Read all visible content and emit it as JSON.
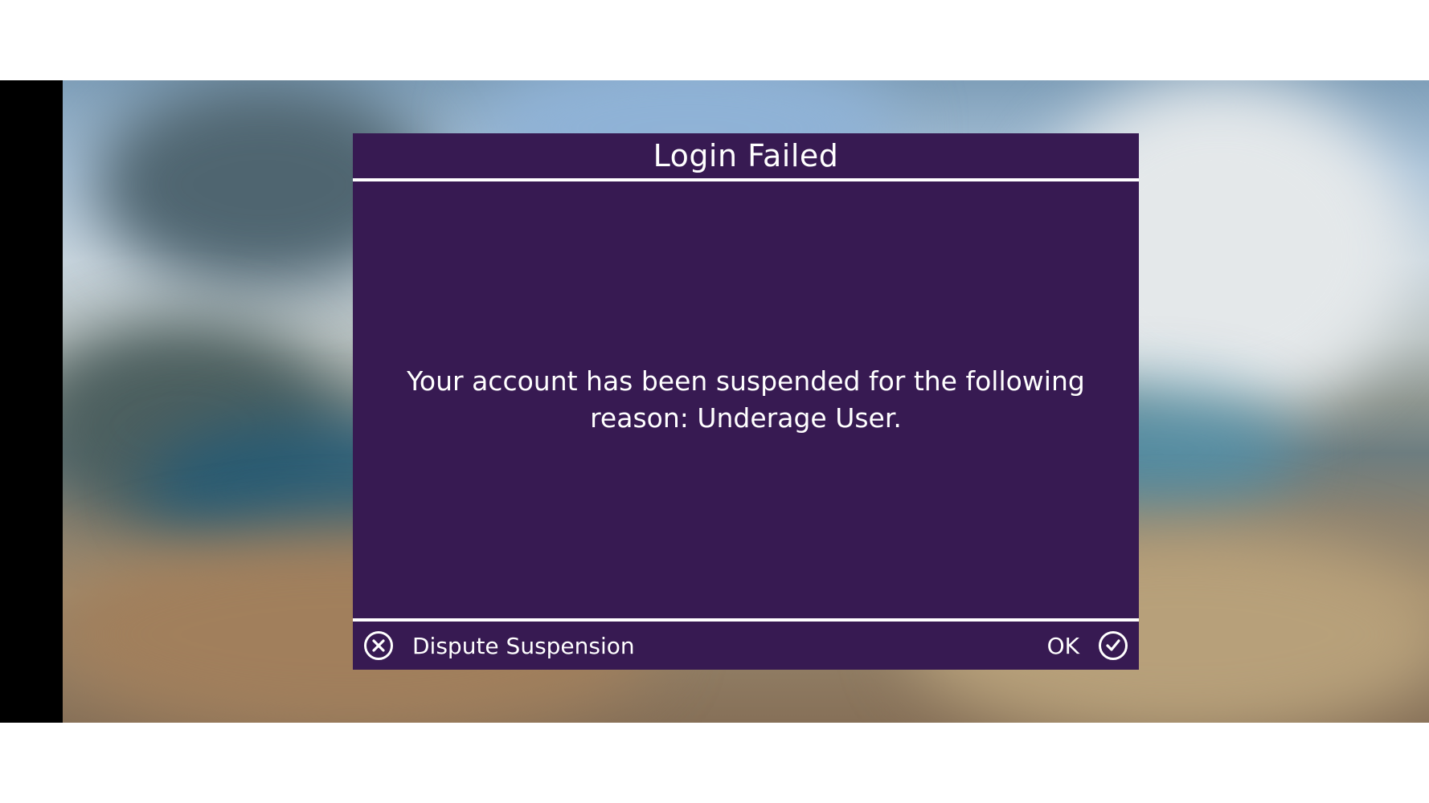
{
  "dialog": {
    "title": "Login Failed",
    "message": "Your account has been suspended for the following reason: Underage User.",
    "dispute_label": "Dispute Suspension",
    "ok_label": "OK",
    "dispute_icon": "x-circle-icon",
    "ok_icon": "check-circle-icon"
  },
  "colors": {
    "dialog_background": "#371a52",
    "text": "#ffffff",
    "divider": "#ffffff"
  }
}
